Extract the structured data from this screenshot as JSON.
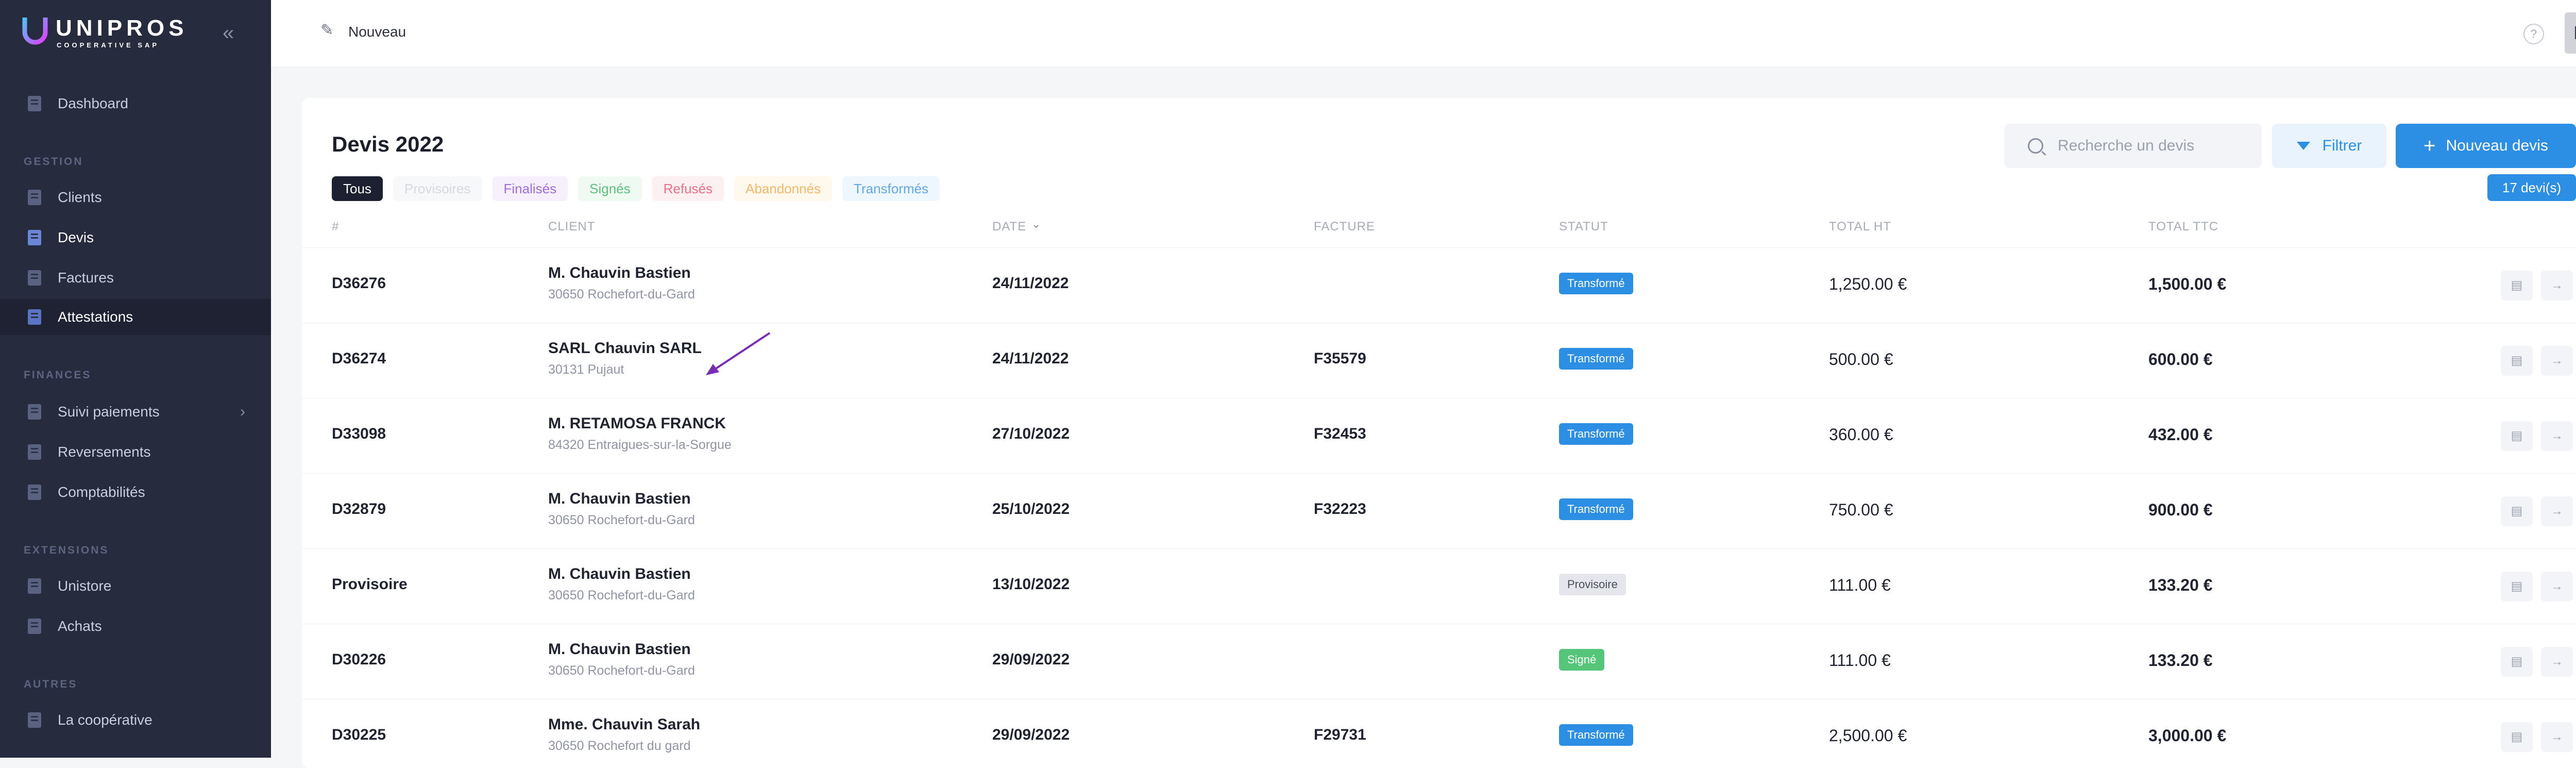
{
  "brand": {
    "name": "UNIPROS",
    "tagline": "COOPERATIVE SAP"
  },
  "sidebar": {
    "sections": [
      {
        "title": "",
        "items": [
          {
            "label": "Dashboard",
            "icon": "dashboard-icon"
          }
        ]
      },
      {
        "title": "GESTION",
        "items": [
          {
            "label": "Clients",
            "icon": "clients-icon"
          },
          {
            "label": "Devis",
            "icon": "document-icon",
            "active": true
          },
          {
            "label": "Factures",
            "icon": "invoice-icon"
          },
          {
            "label": "Attestations",
            "icon": "attestation-icon",
            "highlight": true
          }
        ]
      },
      {
        "title": "FINANCES",
        "items": [
          {
            "label": "Suivi paiements",
            "icon": "payments-icon",
            "chevron": true
          },
          {
            "label": "Reversements",
            "icon": "transfer-icon"
          },
          {
            "label": "Comptabilités",
            "icon": "accounting-icon"
          }
        ]
      },
      {
        "title": "EXTENSIONS",
        "items": [
          {
            "label": "Unistore",
            "icon": "store-icon"
          },
          {
            "label": "Achats",
            "icon": "cart-icon"
          }
        ]
      },
      {
        "title": "AUTRES",
        "items": [
          {
            "label": "La coopérative",
            "icon": "cooperative-icon"
          }
        ]
      }
    ]
  },
  "topbar": {
    "breadcrumb": "Nouveau",
    "avatar_initials": "LC",
    "help": "?"
  },
  "card": {
    "title": "Devis 2022",
    "search_placeholder": "Recherche un devis",
    "filter_label": "Filtrer",
    "new_label": "Nouveau devis",
    "count_label": "17 devi(s)",
    "tabs": [
      "Tous",
      "Provisoires",
      "Finalisés",
      "Signés",
      "Refusés",
      "Abandonnés",
      "Transformés"
    ],
    "columns": [
      "#",
      "CLIENT",
      "DATE",
      "FACTURE",
      "STATUT",
      "TOTAL HT",
      "TOTAL TTC"
    ],
    "rows": [
      {
        "num": "D36276",
        "client": "M. Chauvin Bastien",
        "city": "30650 Rochefort-du-Gard",
        "date": "24/11/2022",
        "facture": "",
        "status": "Transformé",
        "status_color": "blue",
        "ht": "1,250.00 €",
        "ttc": "1,500.00 €"
      },
      {
        "num": "D36274",
        "client": "SARL Chauvin SARL",
        "city": "30131 Pujaut",
        "date": "24/11/2022",
        "facture": "F35579",
        "status": "Transformé",
        "status_color": "blue",
        "ht": "500.00 €",
        "ttc": "600.00 €"
      },
      {
        "num": "D33098",
        "client": "M. RETAMOSA FRANCK",
        "city": "84320 Entraigues-sur-la-Sorgue",
        "date": "27/10/2022",
        "facture": "F32453",
        "status": "Transformé",
        "status_color": "blue",
        "ht": "360.00 €",
        "ttc": "432.00 €"
      },
      {
        "num": "D32879",
        "client": "M. Chauvin Bastien",
        "city": "30650 Rochefort-du-Gard",
        "date": "25/10/2022",
        "facture": "F32223",
        "status": "Transformé",
        "status_color": "blue",
        "ht": "750.00 €",
        "ttc": "900.00 €"
      },
      {
        "num": "Provisoire",
        "client": "M. Chauvin Bastien",
        "city": "30650 Rochefort-du-Gard",
        "date": "13/10/2022",
        "facture": "",
        "status": "Provisoire",
        "status_color": "gray",
        "ht": "111.00 €",
        "ttc": "133.20 €"
      },
      {
        "num": "D30226",
        "client": "M. Chauvin Bastien",
        "city": "30650 Rochefort-du-Gard",
        "date": "29/09/2022",
        "facture": "",
        "status": "Signé",
        "status_color": "green",
        "ht": "111.00 €",
        "ttc": "133.20 €"
      },
      {
        "num": "D30225",
        "client": "Mme. Chauvin Sarah",
        "city": "30650 Rochefort du gard",
        "date": "29/09/2022",
        "facture": "F29731",
        "status": "Transformé",
        "status_color": "blue",
        "ht": "2,500.00 €",
        "ttc": "3,000.00 €"
      }
    ]
  }
}
